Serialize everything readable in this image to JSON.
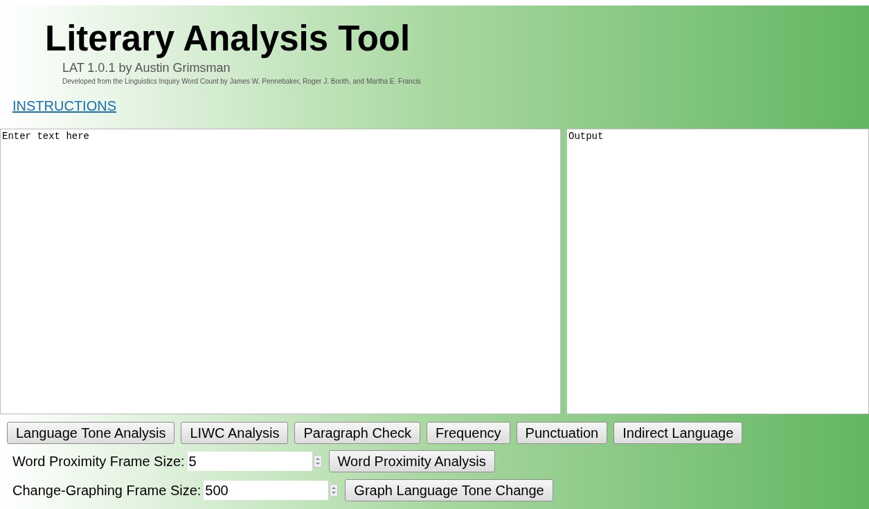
{
  "header": {
    "title": "Literary Analysis Tool",
    "subtitle": "LAT 1.0.1 by Austin Grimsman",
    "credit": "Developed from the Linguistics Inquiry Word Count by James W. Pennebaker, Roger J. Booth, and Martha E. Francis",
    "link": "INSTRUCTIONS"
  },
  "input_area": {
    "value": "Enter text here"
  },
  "output_area": {
    "value": "Output"
  },
  "analysis_buttons": [
    "Language Tone Analysis",
    "LIWC Analysis",
    "Paragraph Check",
    "Frequency",
    "Punctuation",
    "Indirect Language"
  ],
  "frame_rows": [
    {
      "label": "Word Proximity Frame Size:",
      "value": "5",
      "button": "Word Proximity Analysis"
    },
    {
      "label": "Change-Graphing Frame Size:",
      "value": "500",
      "button": "Graph Language Tone Change"
    }
  ]
}
